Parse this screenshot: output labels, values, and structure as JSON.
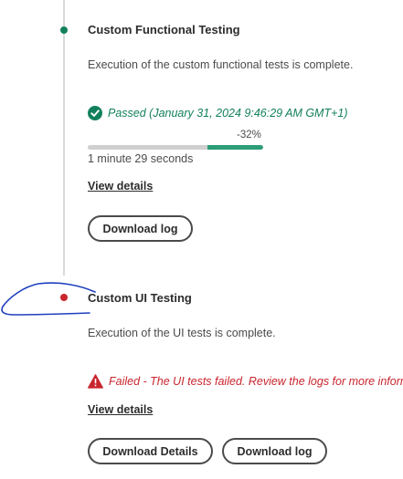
{
  "steps": [
    {
      "title": "Custom Functional Testing",
      "description": "Execution of the custom functional tests is complete.",
      "status_icon": "check-circle-icon",
      "status_text": "Passed (January 31, 2024 9:46:29 AM GMT+1)",
      "progress": {
        "percent_label": "-32%",
        "bar_start_fraction": 0.68,
        "bar_end_fraction": 1.0
      },
      "duration": "1 minute 29 seconds",
      "view_details_label": "View details",
      "download_log_label": "Download log"
    },
    {
      "title": "Custom UI Testing",
      "description": "Execution of the UI tests is complete.",
      "status_icon": "alert-triangle-icon",
      "status_text": "Failed - The UI tests failed. Review the logs for more informa",
      "view_details_label": "View details",
      "download_details_label": "Download Details",
      "download_log_label": "Download log"
    }
  ],
  "colors": {
    "success": "#12805c",
    "error": "#c9252d",
    "progress_fill": "#2d9d78",
    "progress_track": "#cfcfcf",
    "timeline": "#d9d9d9",
    "annotation_ink": "#1f3fbf"
  }
}
